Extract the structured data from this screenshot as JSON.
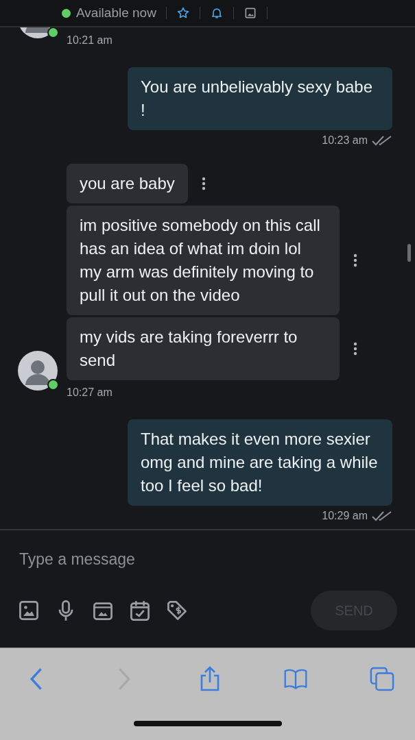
{
  "header": {
    "status": "Available now",
    "online": true
  },
  "messages": [
    {
      "kind": "incoming",
      "online": true,
      "time": "10:21 am"
    },
    {
      "kind": "outgoing",
      "time": "10:23 am",
      "read": true,
      "bubbles": [
        "You are unbelievably sexy babe !"
      ]
    },
    {
      "kind": "incoming",
      "online": true,
      "time": "10:27 am",
      "bubbles": [
        "you are baby",
        "im positive somebody on this call has an idea of what im doin lol my arm was definitely moving to pull it out on the video",
        "my vids are taking foreverrr to send"
      ]
    },
    {
      "kind": "outgoing",
      "time": "10:29 am",
      "read": true,
      "bubbles": [
        "That makes it even more sexier omg and mine are taking a while too I feel so bad!"
      ]
    }
  ],
  "composer": {
    "placeholder": "Type a message",
    "send": "SEND",
    "send_disabled": true
  },
  "browser_bar": {
    "back_disabled": false,
    "forward_disabled": true
  }
}
